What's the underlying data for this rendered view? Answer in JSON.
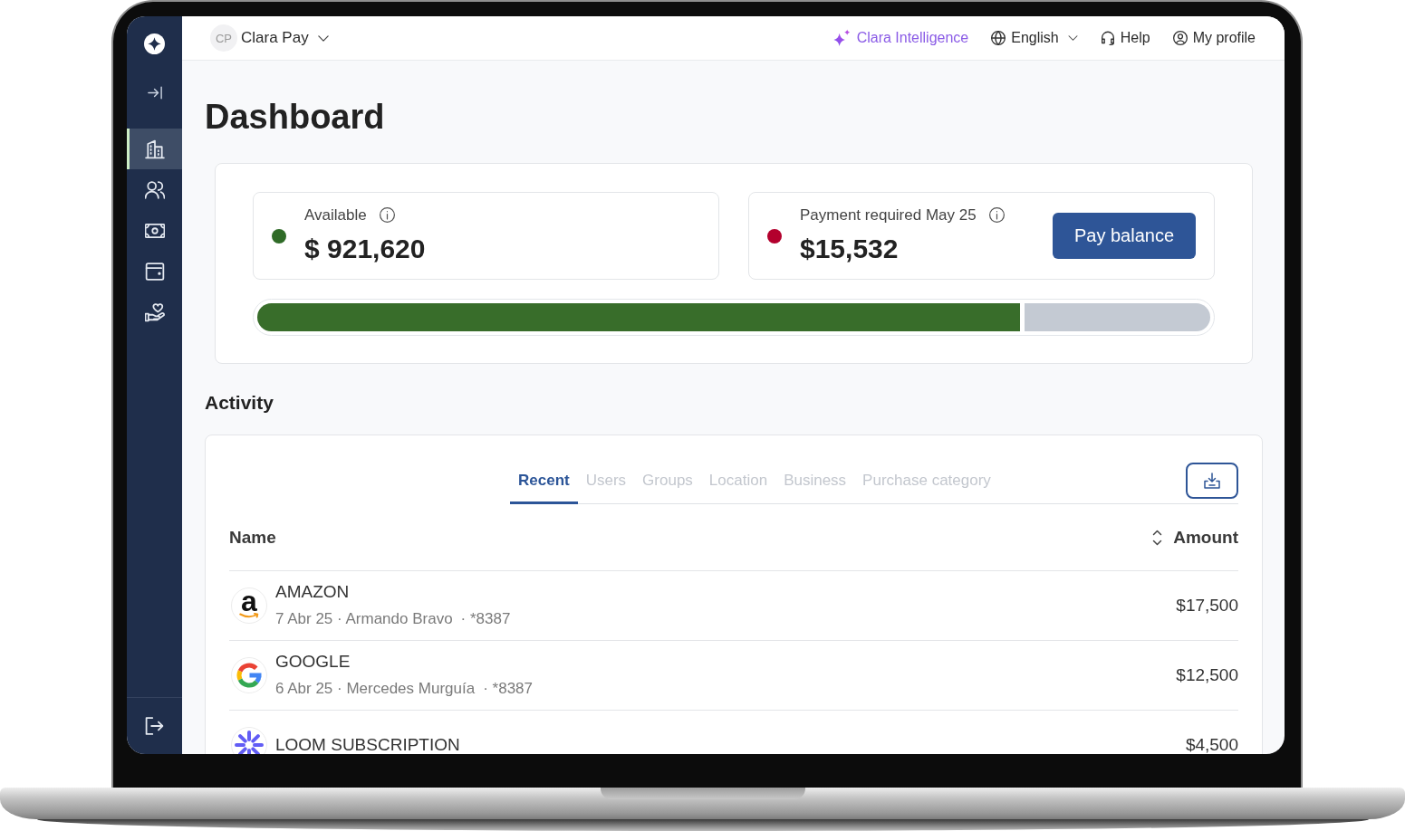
{
  "top_bar": {
    "account": {
      "initials": "CP",
      "name": "Clara Pay"
    },
    "assistant": {
      "label": "Clara Intelligence"
    },
    "language": {
      "label": "English"
    },
    "help": {
      "label": "Help"
    },
    "profile": {
      "label": "My profile"
    }
  },
  "sidebar": {
    "items": [
      {
        "selected": true
      },
      {
        "selected": false
      },
      {
        "selected": false
      },
      {
        "selected": false
      },
      {
        "selected": false
      }
    ]
  },
  "page": {
    "title": "Dashboard"
  },
  "balances": [
    {
      "label": "Available",
      "amount": "$ 921,620",
      "color": "#2f6b27"
    },
    {
      "label": "Payment required May 25",
      "amount": "$15,532",
      "color": "#b3002d",
      "action": "Pay balance"
    }
  ],
  "usage_bar": {
    "level": 0.8
  },
  "activity": {
    "title": "Activity",
    "tabs": [
      {
        "label": "Recent",
        "selected": true
      },
      {
        "label": "Users",
        "selected": false
      },
      {
        "label": "Groups",
        "selected": false
      },
      {
        "label": "Location",
        "selected": false
      },
      {
        "label": "Business",
        "selected": false
      },
      {
        "label": "Purchase category",
        "selected": false
      }
    ],
    "columns": [
      "Name",
      "Amount"
    ],
    "rows": [
      {
        "logo": {
          "kind": "letter",
          "letter": "a"
        },
        "name": "AMAZON",
        "meta": "7 Abr 25 · Armando Bravo",
        "card": "· *8387",
        "amount": "$17,500"
      },
      {
        "logo": {
          "kind": "g-mark"
        },
        "name": "GOOGLE",
        "meta": "6 Abr 25 · Mercedes Murguía",
        "card": "· *8387",
        "amount": "$12,500"
      },
      {
        "logo": {
          "kind": "burst"
        },
        "name": "LOOM SUBSCRIPTION",
        "amount": "$4,500"
      }
    ]
  }
}
